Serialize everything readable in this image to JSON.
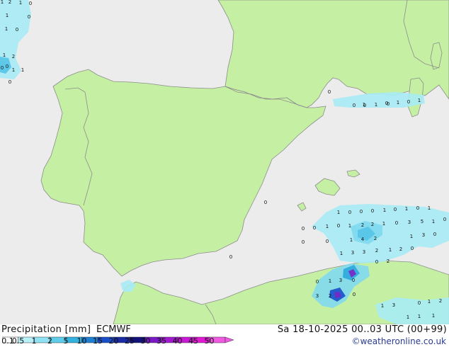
{
  "map": {
    "colors": {
      "sea": "#ececec",
      "land": "#c5f0a3",
      "border": "#8c8c8c",
      "coast": "#8c8c8c"
    },
    "precip_colors": [
      "#a7ebf5",
      "#7fd9ef",
      "#55c4e8",
      "#2ea8dc",
      "#1b4fc9",
      "#7a26c9"
    ],
    "point_values": [
      {
        "v": "1"
      },
      {
        "v": "2"
      },
      {
        "v": "1"
      },
      {
        "v": "0"
      },
      {
        "v": "1"
      },
      {
        "v": "0"
      },
      {
        "v": "1"
      },
      {
        "v": "0"
      },
      {
        "v": "1"
      },
      {
        "v": "2"
      },
      {
        "v": "0"
      },
      {
        "v": "0"
      },
      {
        "v": "1"
      },
      {
        "v": "1"
      },
      {
        "v": "0"
      },
      {
        "v": "0"
      },
      {
        "v": "0"
      },
      {
        "v": "0"
      },
      {
        "v": "1"
      },
      {
        "v": "0"
      },
      {
        "v": "1"
      },
      {
        "v": "0"
      },
      {
        "v": "1"
      },
      {
        "v": "1"
      },
      {
        "v": "0"
      },
      {
        "v": "0"
      },
      {
        "v": "1"
      },
      {
        "v": "0"
      },
      {
        "v": "0"
      },
      {
        "v": "0"
      },
      {
        "v": "1"
      },
      {
        "v": "0"
      },
      {
        "v": "1"
      },
      {
        "v": "0"
      },
      {
        "v": "1"
      },
      {
        "v": "0"
      },
      {
        "v": "0"
      },
      {
        "v": "1"
      },
      {
        "v": "0"
      },
      {
        "v": "1"
      },
      {
        "v": "2"
      },
      {
        "v": "2"
      },
      {
        "v": "1"
      },
      {
        "v": "0"
      },
      {
        "v": "3"
      },
      {
        "v": "5"
      },
      {
        "v": "1"
      },
      {
        "v": "0"
      },
      {
        "v": "0"
      },
      {
        "v": "0"
      },
      {
        "v": "1"
      },
      {
        "v": "4"
      },
      {
        "v": "2"
      },
      {
        "v": "1"
      },
      {
        "v": "3"
      },
      {
        "v": "0"
      },
      {
        "v": "1"
      },
      {
        "v": "3"
      },
      {
        "v": "3"
      },
      {
        "v": "2"
      },
      {
        "v": "1"
      },
      {
        "v": "2"
      },
      {
        "v": "0"
      },
      {
        "v": "0"
      },
      {
        "v": "0"
      },
      {
        "v": "2"
      },
      {
        "v": "0"
      },
      {
        "v": "1"
      },
      {
        "v": "3"
      },
      {
        "v": "0"
      },
      {
        "v": "3"
      },
      {
        "v": "2"
      },
      {
        "v": "0"
      },
      {
        "v": "1"
      },
      {
        "v": "3"
      },
      {
        "v": "0"
      },
      {
        "v": "1"
      },
      {
        "v": "2"
      },
      {
        "v": "1"
      },
      {
        "v": "1"
      },
      {
        "v": "1"
      }
    ]
  },
  "legend": {
    "title": "Precipitation [mm]",
    "model": "ECMWF",
    "ticks": [
      "0.1",
      "0.5",
      "1",
      "2",
      "5",
      "10",
      "15",
      "20",
      "25",
      "30",
      "35",
      "40",
      "45",
      "50"
    ],
    "colors": [
      "#ffffff",
      "#b7f0f7",
      "#8ee2f3",
      "#5fcdea",
      "#33b2e0",
      "#1f7fd3",
      "#1b4fc9",
      "#1a2ba6",
      "#12127a",
      "#7a1ac6",
      "#a21ad0",
      "#c91ad6",
      "#e21ad6",
      "#f05ae0"
    ]
  },
  "valid_time": "Sa 18-10-2025 00..03 UTC (00+99)",
  "copyright": "©weatheronline.co.uk"
}
